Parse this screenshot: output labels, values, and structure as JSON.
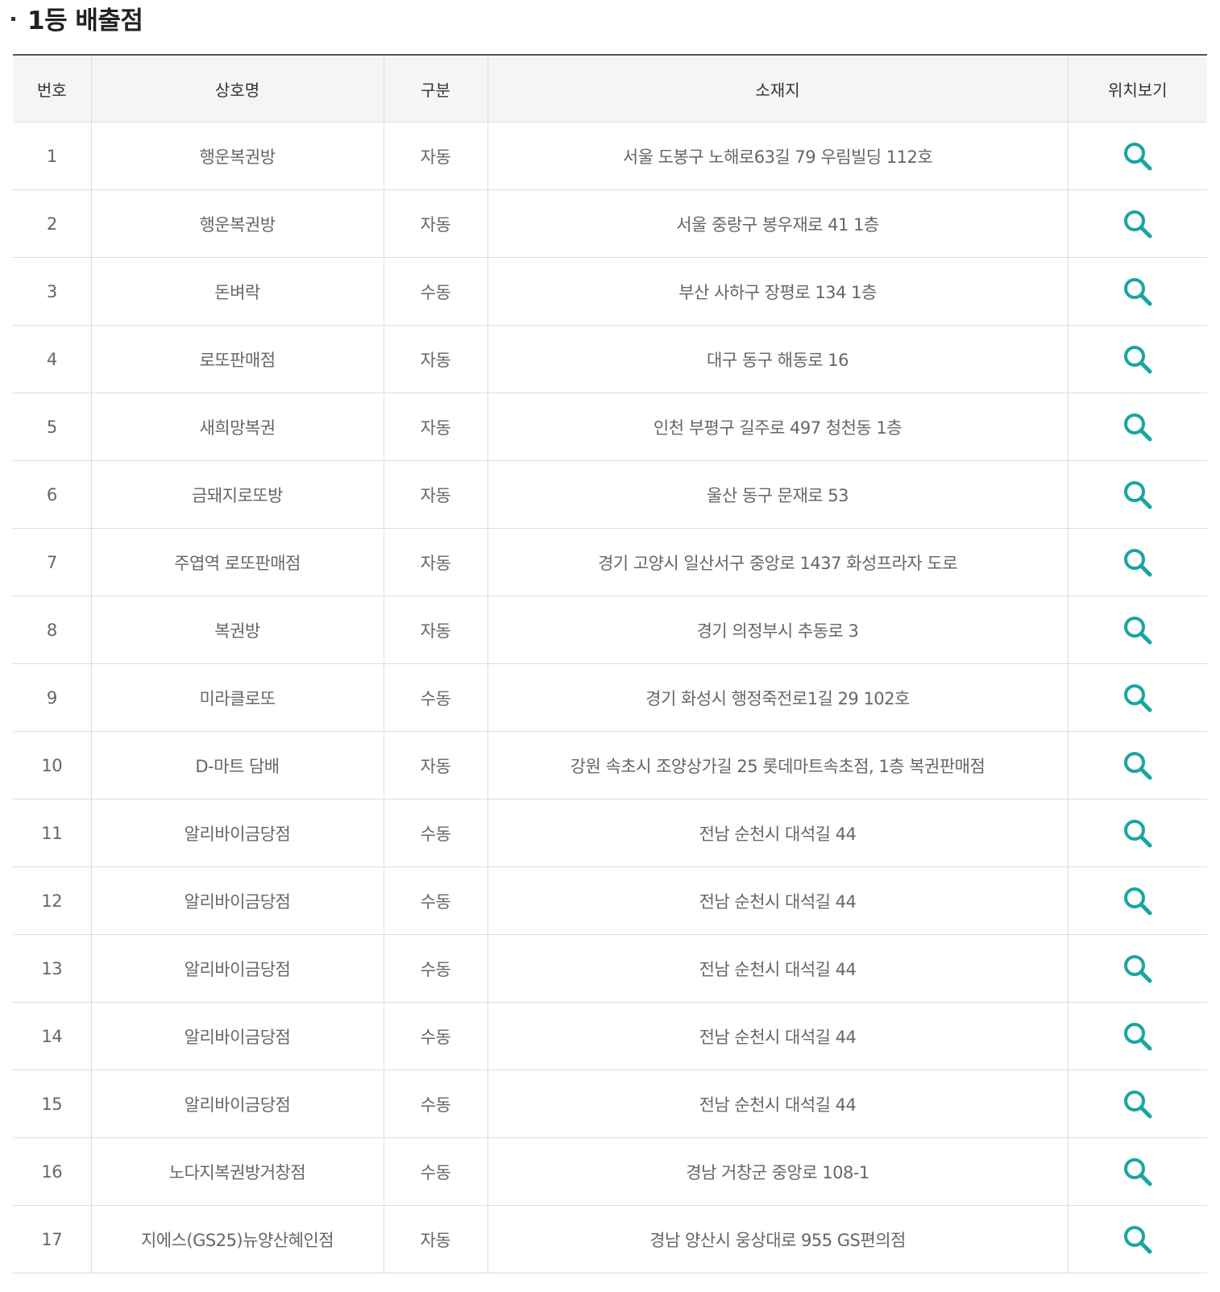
{
  "section": {
    "title": "1등 배출점"
  },
  "table": {
    "headers": {
      "no": "번호",
      "name": "상호명",
      "type": "구분",
      "address": "소재지",
      "location": "위치보기"
    },
    "location_icon": "search-icon",
    "icon_color": "#1aa5a0",
    "rows": [
      {
        "no": "1",
        "name": "행운복권방",
        "type": "자동",
        "address": "서울 도봉구 노해로63길 79 우림빌딩 112호"
      },
      {
        "no": "2",
        "name": "행운복권방",
        "type": "자동",
        "address": "서울 중랑구 봉우재로 41 1층"
      },
      {
        "no": "3",
        "name": "돈벼락",
        "type": "수동",
        "address": "부산 사하구 장평로 134 1층"
      },
      {
        "no": "4",
        "name": "로또판매점",
        "type": "자동",
        "address": "대구 동구 해동로 16"
      },
      {
        "no": "5",
        "name": "새희망복권",
        "type": "자동",
        "address": "인천 부평구 길주로 497 청천동 1층"
      },
      {
        "no": "6",
        "name": "금돼지로또방",
        "type": "자동",
        "address": "울산 동구 문재로 53"
      },
      {
        "no": "7",
        "name": "주엽역 로또판매점",
        "type": "자동",
        "address": "경기 고양시 일산서구 중앙로 1437 화성프라자 도로"
      },
      {
        "no": "8",
        "name": "복권방",
        "type": "자동",
        "address": "경기 의정부시 추동로 3"
      },
      {
        "no": "9",
        "name": "미라클로또",
        "type": "수동",
        "address": "경기 화성시 행정죽전로1길 29 102호"
      },
      {
        "no": "10",
        "name": "D-마트 담배",
        "type": "자동",
        "address": "강원 속초시 조양상가길 25 롯데마트속초점, 1층 복권판매점"
      },
      {
        "no": "11",
        "name": "알리바이금당점",
        "type": "수동",
        "address": "전남 순천시 대석길 44"
      },
      {
        "no": "12",
        "name": "알리바이금당점",
        "type": "수동",
        "address": "전남 순천시 대석길 44"
      },
      {
        "no": "13",
        "name": "알리바이금당점",
        "type": "수동",
        "address": "전남 순천시 대석길 44"
      },
      {
        "no": "14",
        "name": "알리바이금당점",
        "type": "수동",
        "address": "전남 순천시 대석길 44"
      },
      {
        "no": "15",
        "name": "알리바이금당점",
        "type": "수동",
        "address": "전남 순천시 대석길 44"
      },
      {
        "no": "16",
        "name": "노다지복권방거창점",
        "type": "수동",
        "address": "경남 거창군 중앙로 108-1"
      },
      {
        "no": "17",
        "name": "지에스(GS25)뉴양산혜인점",
        "type": "자동",
        "address": "경남 양산시 웅상대로 955 GS편의점"
      }
    ]
  }
}
